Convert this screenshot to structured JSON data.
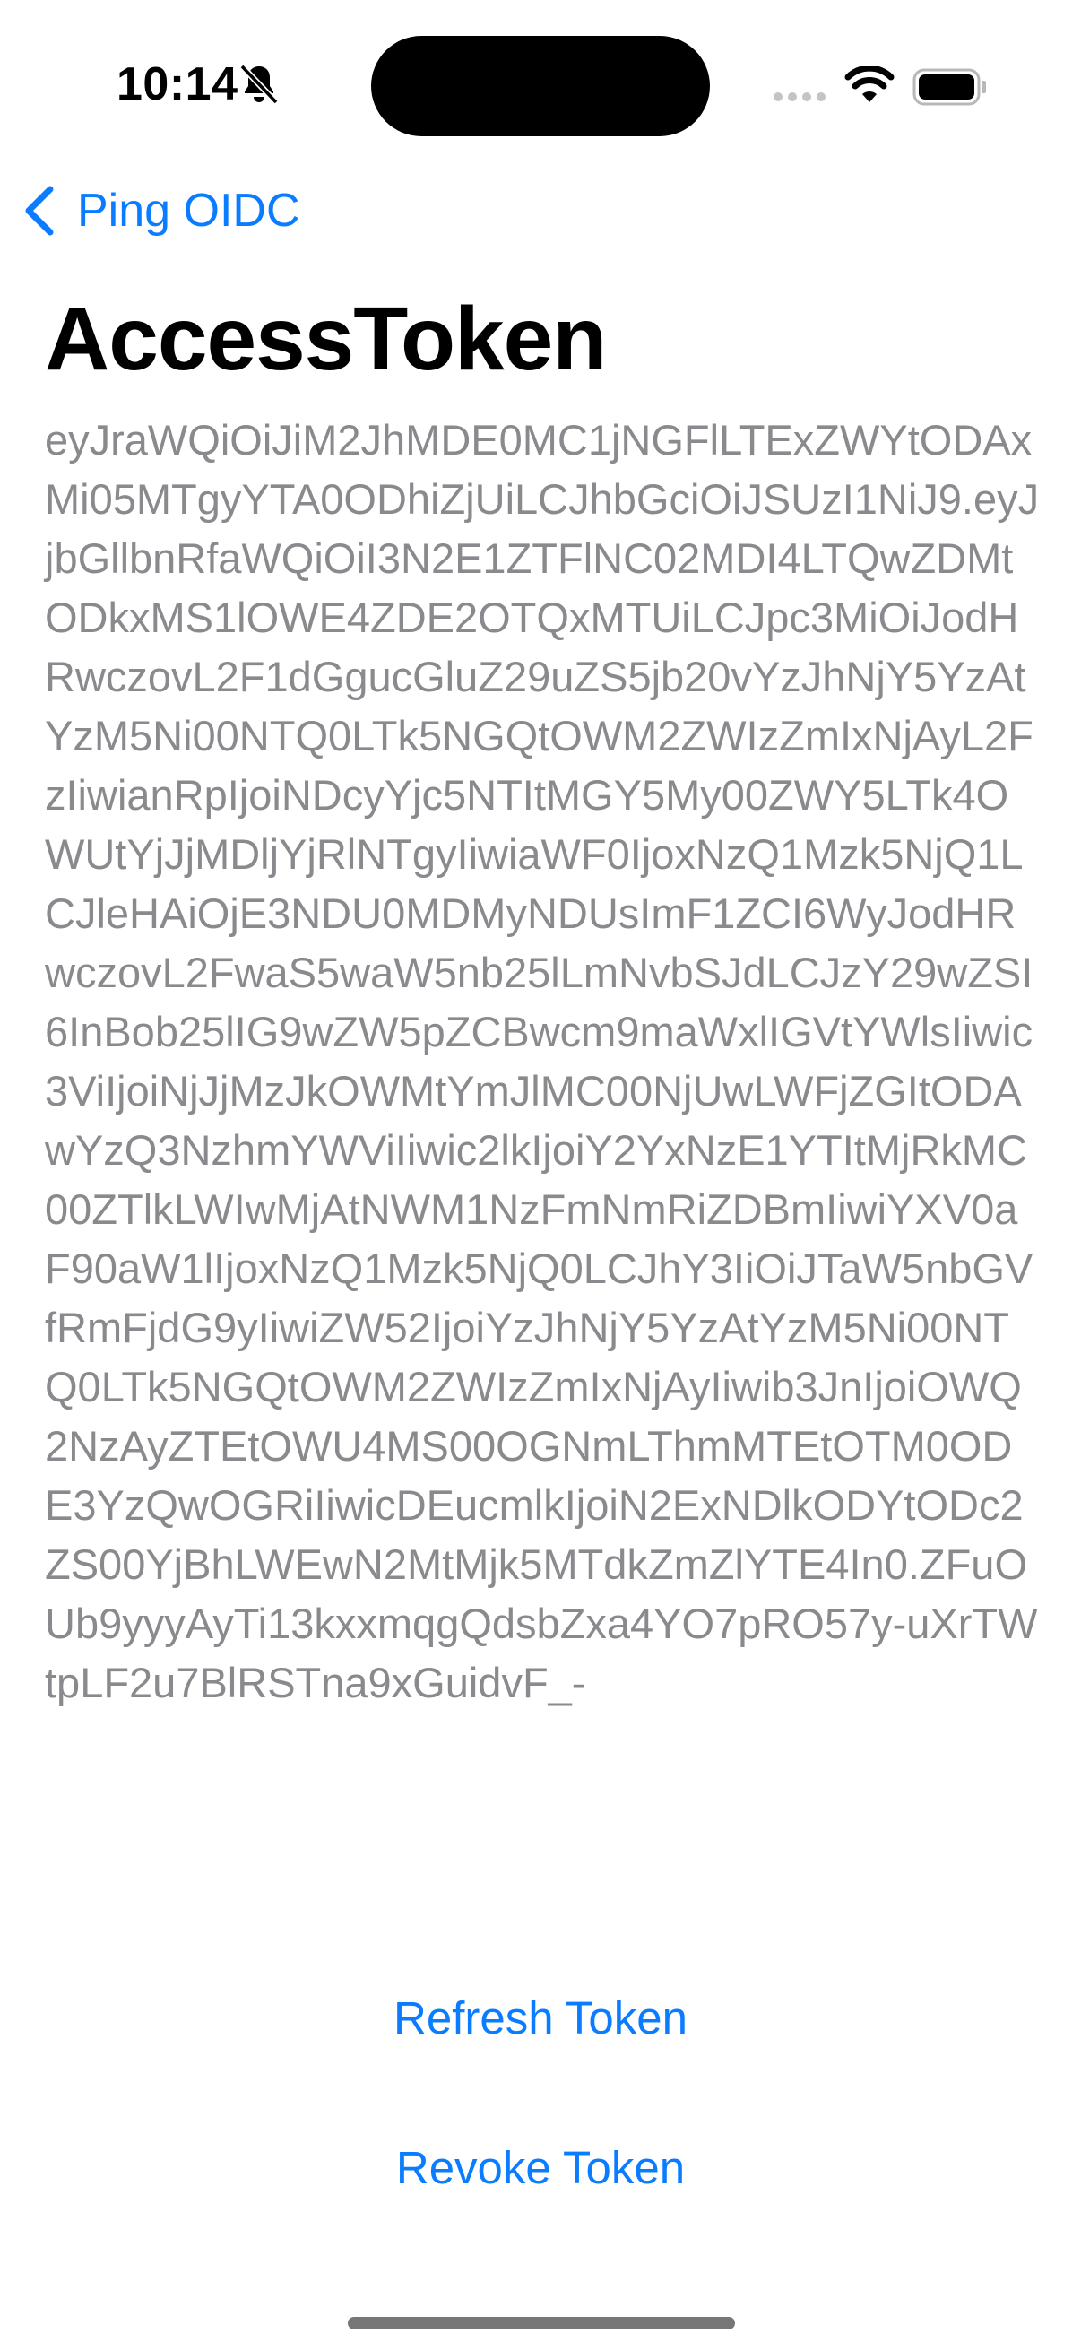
{
  "status_bar": {
    "time": "10:14",
    "icons": [
      "bell-slash-icon",
      "cellular-signal-icon",
      "wifi-icon",
      "battery-icon"
    ]
  },
  "nav": {
    "back_label": "Ping OIDC",
    "back_icon": "chevron-left-icon"
  },
  "page": {
    "title": "AccessToken",
    "token": "eyJraWQiOiJiM2JhMDE0MC1jNGFlLTExZWYtODAxMi05MTgyYTA0ODhiZjUiLCJhbGciOiJSUzI1NiJ9.eyJjbGllbnRfaWQiOiI3N2E1ZTFlNC02MDI4LTQwZDMtODkxMS1lOWE4ZDE2OTQxMTUiLCJpc3MiOiJodHRwczovL2F1dGgucGluZ29uZS5jb20vYzJhNjY5YzAtYzM5Ni00NTQ0LTk5NGQtOWM2ZWIzZmIxNjAyL2FzIiwianRpIjoiNDcyYjc5NTItMGY5My00ZWY5LTk4OWUtYjJjMDljYjRlNTgyIiwiaWF0IjoxNzQ1Mzk5NjQ1LCJleHAiOjE3NDU0MDMyNDUsImF1ZCI6WyJodHRwczovL2FwaS5waW5nb25lLmNvbSJdLCJzY29wZSI6InBob25lIG9wZW5pZCBwcm9maWxlIGVtYWlsIiwic3ViIjoiNjJjMzJkOWMtYmJlMC00NjUwLWFjZGItODAwYzQ3NzhmYWViIiwic2lkIjoiY2YxNzE1YTItMjRkMC00ZTlkLWIwMjAtNWM1NzFmNmRiZDBmIiwiYXV0aF90aW1lIjoxNzQ1Mzk5NjQ0LCJhY3IiOiJTaW5nbGVfRmFjdG9yIiwiZW52IjoiYzJhNjY5YzAtYzM5Ni00NTQ0LTk5NGQtOWM2ZWIzZmIxNjAyIiwib3JnIjoiOWQ2NzAyZTEtOWU4MS00OGNmLThmMTEtOTM0ODE3YzQwOGRiIiwicDEucmlkIjoiN2ExNDlkODYtODc2ZS00YjBhLWEwN2MtMjk5MTdkZmZlYTE4In0.ZFuOUb9yyyAyTi13kxxmqgQdsbZxa4YO7pRO57y-uXrTWtpLF2u7BlRSTna9xGuidvF_-"
  },
  "actions": {
    "refresh_label": "Refresh Token",
    "revoke_label": "Revoke Token"
  },
  "colors": {
    "accent": "#0a7cff",
    "token_text": "#8a8a8e",
    "background": "#ffffff"
  }
}
